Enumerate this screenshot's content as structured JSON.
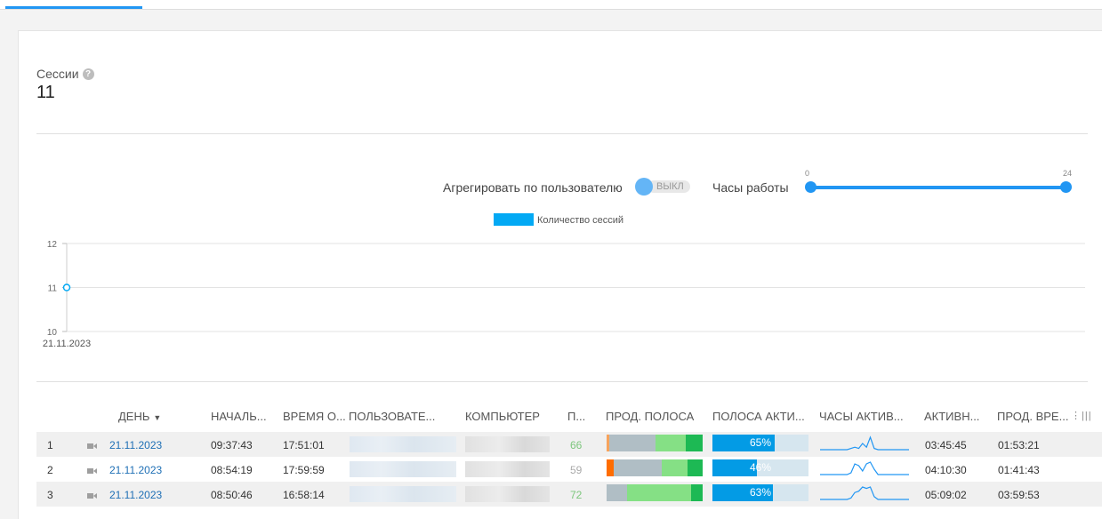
{
  "metric": {
    "label": "Сессии",
    "value": "11"
  },
  "controls": {
    "aggregate_label": "Агрегировать по пользователю",
    "aggregate_toggle": "ВЫКЛ",
    "hours_label": "Часы работы",
    "hours_min": "0",
    "hours_max": "24"
  },
  "chart_data": {
    "type": "line",
    "legend": [
      "Количество сессий"
    ],
    "x": [
      "21.11.2023"
    ],
    "series": [
      {
        "name": "Количество сессий",
        "values": [
          11
        ],
        "color": "#03a9f4"
      }
    ],
    "yticks": [
      "12",
      "11",
      "10"
    ],
    "ylim": [
      10,
      12
    ],
    "grid": true,
    "legend_position": "top-center"
  },
  "table": {
    "columns": [
      "ДЕНЬ",
      "НАЧАЛЬ...",
      "ВРЕМЯ О...",
      "ПОЛЬЗОВАТЕ...",
      "КОМПЬЮТЕР",
      "П...",
      "ПРОД. ПОЛОСА",
      "ПОЛОСА АКТИ...",
      "ЧАСЫ АКТИВ...",
      "АКТИВН...",
      "ПРОД. ВРЕ..."
    ],
    "sort_indicator": "▼",
    "rows": [
      {
        "n": "1",
        "day": "21.11.2023",
        "start": "09:37:43",
        "end": "17:51:01",
        "p": "66",
        "p_color": "green",
        "active_pct": "65%",
        "active_val": 0.65,
        "active_time": "03:45:45",
        "prod_time": "01:53:21",
        "prod_segments": [
          {
            "color": "#f7a35c",
            "w": 3
          },
          {
            "color": "#b0bec5",
            "w": 48
          },
          {
            "color": "#85e085",
            "w": 31
          },
          {
            "color": "#1db954",
            "w": 18
          }
        ],
        "spark": [
          0,
          0,
          0,
          0,
          0,
          0,
          0,
          0,
          1,
          2,
          1,
          5,
          2,
          10,
          1,
          0,
          0,
          0,
          0,
          0,
          0,
          0,
          0,
          0
        ]
      },
      {
        "n": "2",
        "day": "21.11.2023",
        "start": "08:54:19",
        "end": "17:59:59",
        "p": "59",
        "p_color": "gray",
        "active_pct": "46%",
        "active_val": 0.46,
        "active_time": "04:10:30",
        "prod_time": "01:41:43",
        "prod_segments": [
          {
            "color": "#ff6d00",
            "w": 7
          },
          {
            "color": "#b0bec5",
            "w": 50
          },
          {
            "color": "#85e085",
            "w": 27
          },
          {
            "color": "#1db954",
            "w": 16
          }
        ],
        "spark": [
          0,
          0,
          0,
          0,
          0,
          0,
          0,
          0,
          1,
          6,
          5,
          2,
          6,
          7,
          3,
          0,
          0,
          0,
          0,
          0,
          0,
          0,
          0,
          0
        ]
      },
      {
        "n": "3",
        "day": "21.11.2023",
        "start": "08:50:46",
        "end": "16:58:14",
        "p": "72",
        "p_color": "green",
        "active_pct": "63%",
        "active_val": 0.63,
        "active_time": "05:09:02",
        "prod_time": "03:59:53",
        "prod_segments": [
          {
            "color": "#b0bec5",
            "w": 21
          },
          {
            "color": "#85e085",
            "w": 67
          },
          {
            "color": "#1db954",
            "w": 12
          }
        ],
        "spark": [
          0,
          0,
          0,
          0,
          0,
          0,
          0,
          0,
          1,
          5,
          6,
          9,
          8,
          9,
          2,
          0,
          0,
          0,
          0,
          0,
          0,
          0,
          0,
          0
        ]
      }
    ]
  }
}
